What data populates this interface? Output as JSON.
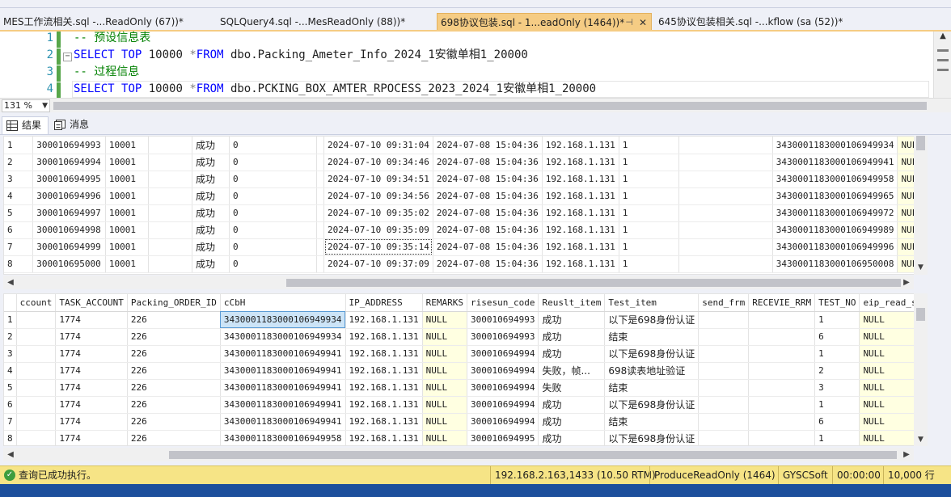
{
  "tabs": [
    {
      "label": "MES工作流相关.sql -...ReadOnly (67))*",
      "active": false
    },
    {
      "label": "SQLQuery4.sql -...MesReadOnly (88))*",
      "active": false
    },
    {
      "label": "698协议包装.sql - 1...eadOnly (1464))*",
      "active": true
    },
    {
      "label": "645协议包装相关.sql -...kflow (sa (52))*",
      "active": false
    }
  ],
  "editor": {
    "lines": [
      {
        "num": "1",
        "comment": "-- 预设信息表"
      },
      {
        "num": "2",
        "kw1": "SELECT",
        "kw2": "TOP",
        "num_val": "10000",
        "star": "*",
        "kw3": "FROM",
        "table": "dbo.Packing_Ameter_Info_2024_1安徽单相1_20000"
      },
      {
        "num": "3",
        "comment": "-- 过程信息"
      },
      {
        "num": "4",
        "kw1": "SELECT",
        "kw2": "TOP",
        "num_val": "10000",
        "star": "*",
        "kw3": "FROM",
        "table": "dbo.PCKING_BOX_AMTER_RPOCESS_2023_2024_1安徽单相1_20000"
      }
    ]
  },
  "zoom": "131 %",
  "result_tabs": {
    "results": "结果",
    "messages": "消息"
  },
  "grid1": {
    "rows": [
      [
        "1",
        "300010694993",
        "10001",
        "",
        "成功",
        "0",
        "",
        "2024-07-10 09:31:04",
        "2024-07-08 15:04:36",
        "192.168.1.131",
        "1",
        "",
        "3430001183000106949934",
        "NULL"
      ],
      [
        "2",
        "300010694994",
        "10001",
        "",
        "成功",
        "0",
        "",
        "2024-07-10 09:34:46",
        "2024-07-08 15:04:36",
        "192.168.1.131",
        "1",
        "",
        "3430001183000106949941",
        "NULL"
      ],
      [
        "3",
        "300010694995",
        "10001",
        "",
        "成功",
        "0",
        "",
        "2024-07-10 09:34:51",
        "2024-07-08 15:04:36",
        "192.168.1.131",
        "1",
        "",
        "3430001183000106949958",
        "NULL"
      ],
      [
        "4",
        "300010694996",
        "10001",
        "",
        "成功",
        "0",
        "",
        "2024-07-10 09:34:56",
        "2024-07-08 15:04:36",
        "192.168.1.131",
        "1",
        "",
        "3430001183000106949965",
        "NULL"
      ],
      [
        "5",
        "300010694997",
        "10001",
        "",
        "成功",
        "0",
        "",
        "2024-07-10 09:35:02",
        "2024-07-08 15:04:36",
        "192.168.1.131",
        "1",
        "",
        "3430001183000106949972",
        "NULL"
      ],
      [
        "6",
        "300010694998",
        "10001",
        "",
        "成功",
        "0",
        "",
        "2024-07-10 09:35:09",
        "2024-07-08 15:04:36",
        "192.168.1.131",
        "1",
        "",
        "3430001183000106949989",
        "NULL"
      ],
      [
        "7",
        "300010694999",
        "10001",
        "",
        "成功",
        "0",
        "",
        "2024-07-10 09:35:14",
        "2024-07-08 15:04:36",
        "192.168.1.131",
        "1",
        "",
        "3430001183000106949996",
        "NULL"
      ],
      [
        "8",
        "300010695000",
        "10001",
        "",
        "成功",
        "0",
        "",
        "2024-07-10 09:37:09",
        "2024-07-08 15:04:36",
        "192.168.1.131",
        "1",
        "",
        "3430001183000106950008",
        "NULL"
      ]
    ]
  },
  "grid2": {
    "headers": [
      "",
      "ccount",
      "TASK_ACCOUNT",
      "Packing_ORDER_ID",
      "cCbH",
      "IP_ADDRESS",
      "REMARKS",
      "risesun_code",
      "Reuslt_item",
      "Test_item",
      "send_frm",
      "RECEVIE_RRM",
      "TEST_NO",
      "eip_read_sta"
    ],
    "rows": [
      [
        "1",
        "",
        "1774",
        "226",
        "3430001183000106949934",
        "192.168.1.131",
        "NULL",
        "300010694993",
        "成功",
        "以下是698身份认证",
        "",
        "",
        "1",
        "NULL"
      ],
      [
        "2",
        "",
        "1774",
        "226",
        "3430001183000106949934",
        "192.168.1.131",
        "NULL",
        "300010694993",
        "成功",
        "结束",
        "",
        "",
        "6",
        "NULL"
      ],
      [
        "3",
        "",
        "1774",
        "226",
        "3430001183000106949941",
        "192.168.1.131",
        "NULL",
        "300010694994",
        "成功",
        "以下是698身份认证",
        "",
        "",
        "1",
        "NULL"
      ],
      [
        "4",
        "",
        "1774",
        "226",
        "3430001183000106949941",
        "192.168.1.131",
        "NULL",
        "300010694994",
        "失败，帧...",
        "698读表地址验证",
        "",
        "",
        "2",
        "NULL"
      ],
      [
        "5",
        "",
        "1774",
        "226",
        "3430001183000106949941",
        "192.168.1.131",
        "NULL",
        "300010694994",
        "失败",
        "结束",
        "",
        "",
        "3",
        "NULL"
      ],
      [
        "6",
        "",
        "1774",
        "226",
        "3430001183000106949941",
        "192.168.1.131",
        "NULL",
        "300010694994",
        "成功",
        "以下是698身份认证",
        "",
        "",
        "1",
        "NULL"
      ],
      [
        "7",
        "",
        "1774",
        "226",
        "3430001183000106949941",
        "192.168.1.131",
        "NULL",
        "300010694994",
        "成功",
        "结束",
        "",
        "",
        "6",
        "NULL"
      ],
      [
        "8",
        "",
        "1774",
        "226",
        "3430001183000106949958",
        "192.168.1.131",
        "NULL",
        "300010694995",
        "成功",
        "以下是698身份认证",
        "",
        "",
        "1",
        "NULL"
      ]
    ]
  },
  "status": {
    "message": "查询已成功执行。",
    "server": "192.168.2.163,1433 (10.50 RTM)",
    "db": "ProduceReadOnly (1464)",
    "user": "GYSCSoft",
    "time": "00:00:00",
    "rows": "10,000 行"
  }
}
